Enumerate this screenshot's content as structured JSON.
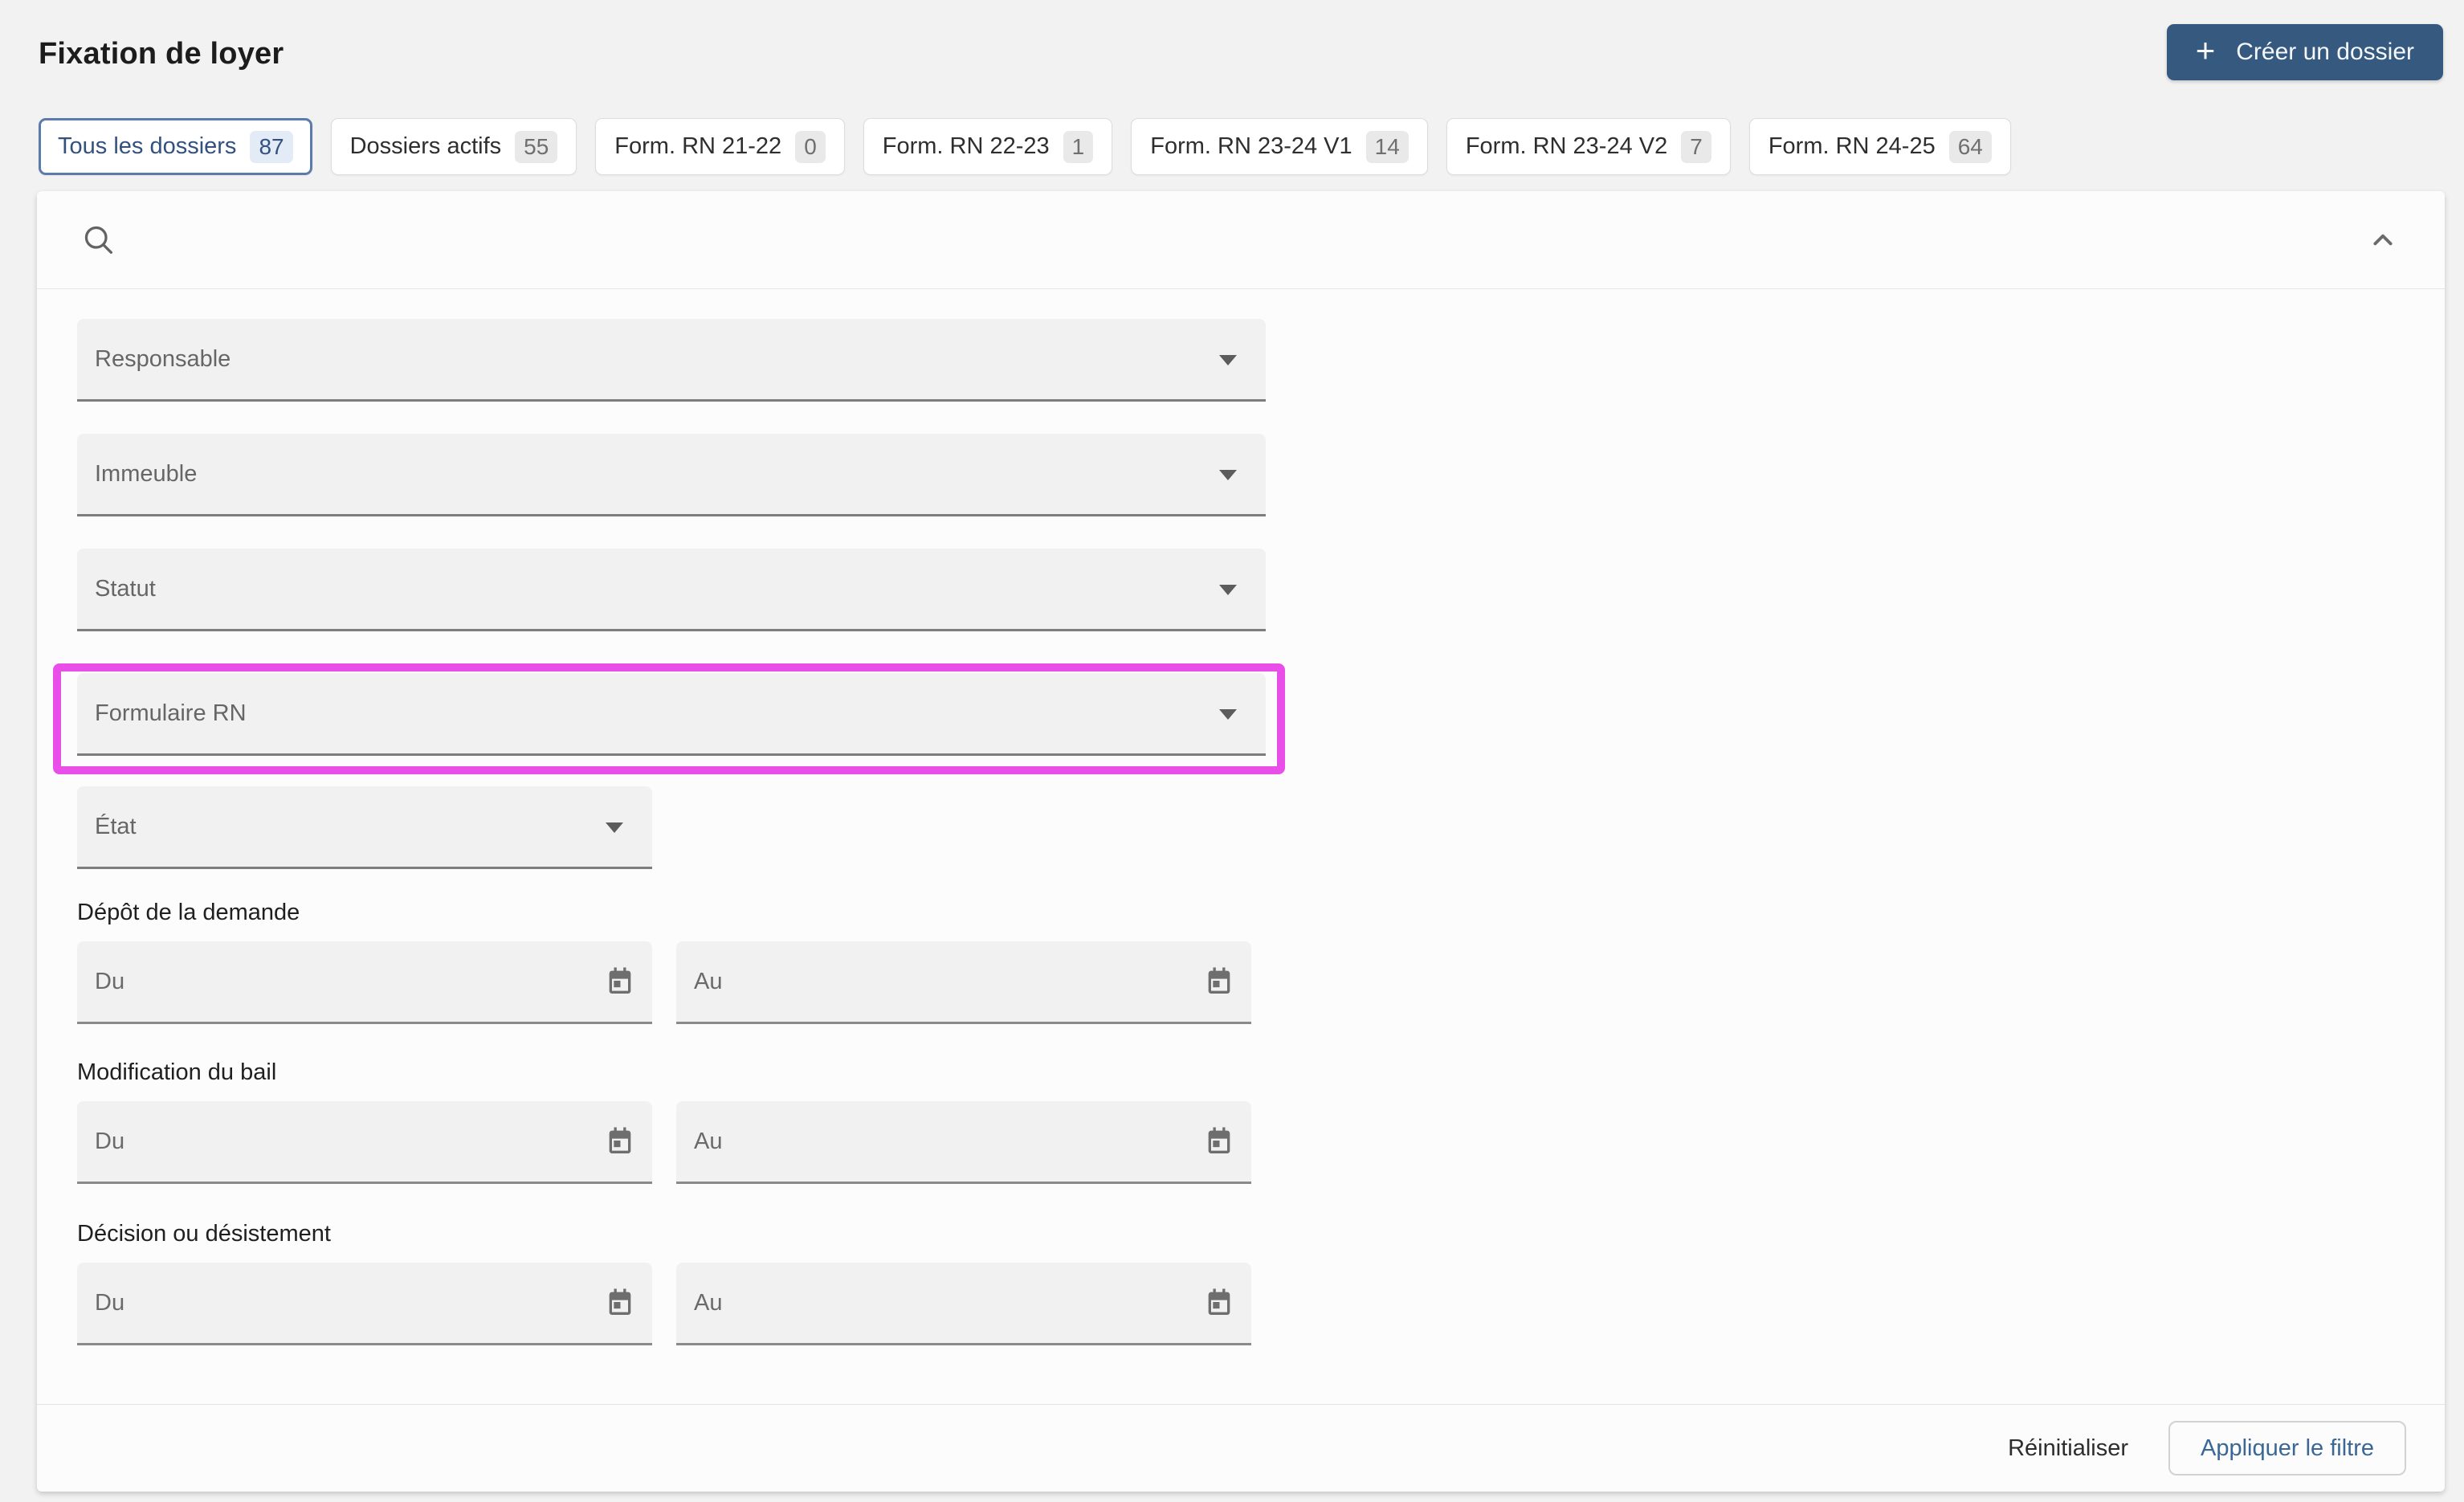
{
  "page": {
    "title": "Fixation de loyer"
  },
  "header": {
    "create_button_label": "Créer un dossier",
    "plus_glyph": "+"
  },
  "tabs": [
    {
      "label": "Tous les dossiers",
      "count": "87",
      "selected": true
    },
    {
      "label": "Dossiers actifs",
      "count": "55",
      "selected": false
    },
    {
      "label": "Form. RN 21-22",
      "count": "0",
      "selected": false
    },
    {
      "label": "Form. RN 22-23",
      "count": "1",
      "selected": false
    },
    {
      "label": "Form. RN 23-24 V1",
      "count": "14",
      "selected": false
    },
    {
      "label": "Form. RN 23-24 V2",
      "count": "7",
      "selected": false
    },
    {
      "label": "Form. RN 24-25",
      "count": "64",
      "selected": false
    }
  ],
  "panel": {
    "search": {
      "value": "",
      "placeholder": ""
    },
    "dropdowns": [
      {
        "label": "Responsable"
      },
      {
        "label": "Immeuble"
      },
      {
        "label": "Statut"
      },
      {
        "label": "Formulaire RN",
        "highlighted": true
      },
      {
        "label": "État"
      }
    ],
    "date_sections": [
      {
        "title": "Dépôt de la demande",
        "from": "Du",
        "to": "Au"
      },
      {
        "title": "Modification du bail",
        "from": "Du",
        "to": "Au"
      },
      {
        "title": "Décision ou désistement",
        "from": "Du",
        "to": "Au"
      }
    ],
    "footer": {
      "reset": "Réinitialiser",
      "apply": "Appliquer le filtre"
    }
  },
  "colors": {
    "primary_button": "#35597f",
    "selected_tab_text": "#33517e",
    "selected_tab_border": "#5b7cab",
    "highlight_box": "#e94ee9",
    "apply_text": "#3a6795",
    "field_background": "#f1f1f1",
    "page_background": "#f2f2f2"
  }
}
